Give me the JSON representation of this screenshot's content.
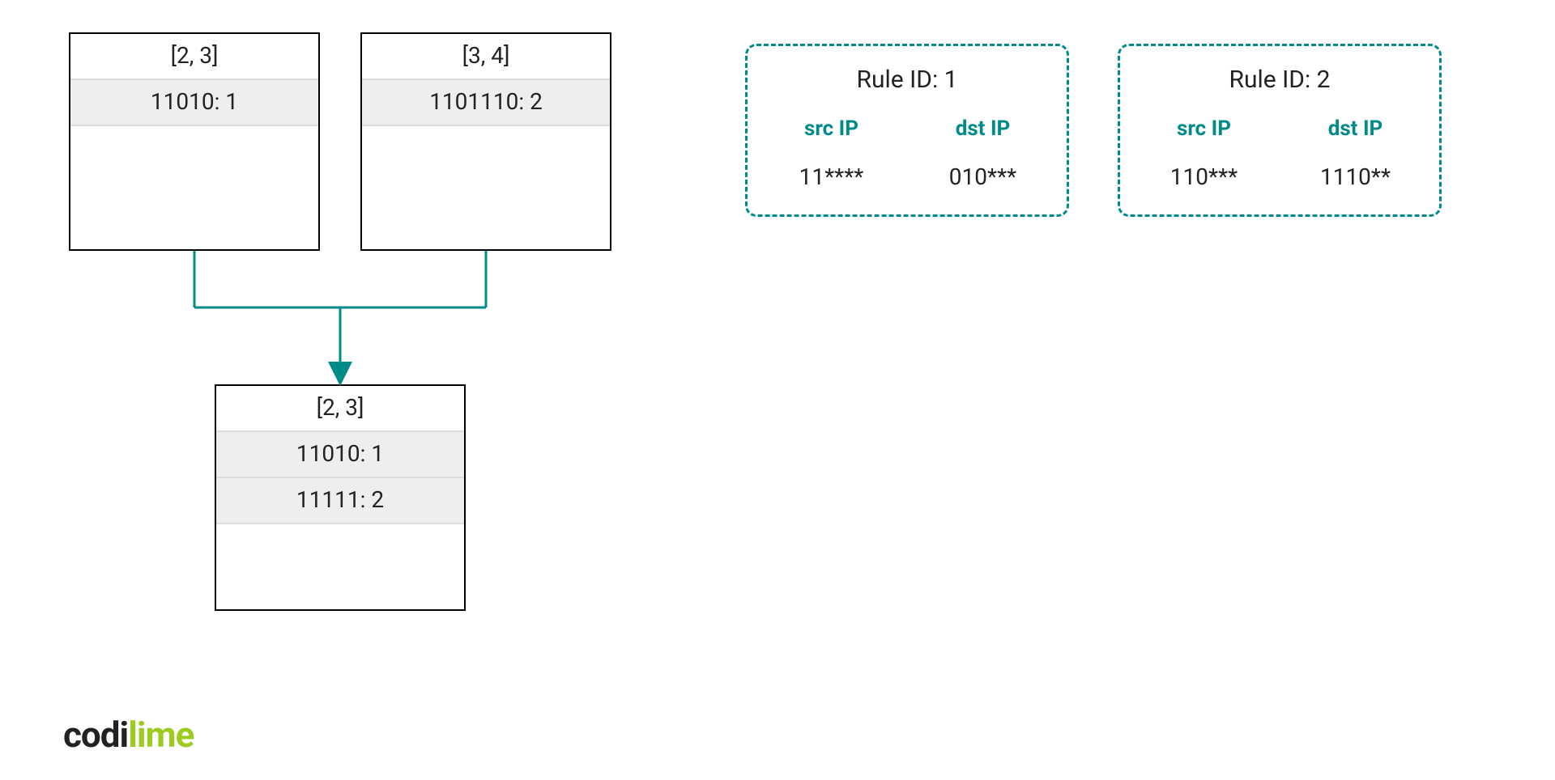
{
  "nodes": {
    "top_left": {
      "header": "[2, 3]",
      "rows": [
        "11010: 1"
      ]
    },
    "top_right": {
      "header": "[3, 4]",
      "rows": [
        "1101110: 2"
      ]
    },
    "bottom": {
      "header": "[2, 3]",
      "rows": [
        "11010: 1",
        "11111: 2"
      ]
    }
  },
  "rules": {
    "r1": {
      "title": "Rule ID: 1",
      "cols": [
        {
          "head": "src IP",
          "val": "11****"
        },
        {
          "head": "dst IP",
          "val": "010***"
        }
      ]
    },
    "r2": {
      "title": "Rule ID: 2",
      "cols": [
        {
          "head": "src IP",
          "val": "110***"
        },
        {
          "head": "dst IP",
          "val": "1110**"
        }
      ]
    }
  },
  "logo": {
    "part1": "codi",
    "part2": "lime"
  }
}
